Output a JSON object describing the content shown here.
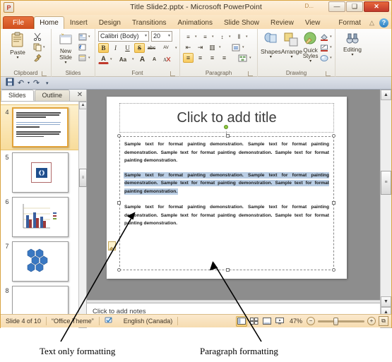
{
  "window": {
    "title": "Title Slide2.pptx  -  Microsoft PowerPoint",
    "app_logo": "P",
    "doc_badge": "D...",
    "minimize": "—",
    "maximize": "❑",
    "close": "✕"
  },
  "tabs": [
    {
      "label": "File",
      "state": "file"
    },
    {
      "label": "Home",
      "state": "active"
    },
    {
      "label": "Insert",
      "state": ""
    },
    {
      "label": "Design",
      "state": ""
    },
    {
      "label": "Transitions",
      "state": ""
    },
    {
      "label": "Animations",
      "state": ""
    },
    {
      "label": "Slide Show",
      "state": ""
    },
    {
      "label": "Review",
      "state": ""
    },
    {
      "label": "View",
      "state": ""
    },
    {
      "label": "Format",
      "state": "contextual"
    }
  ],
  "tab_right": {
    "minimize_ribbon": "△",
    "help": "?"
  },
  "ribbon": {
    "clipboard": {
      "label": "Clipboard",
      "paste_label": "Paste",
      "paste_caret": "▾",
      "cut_icon": "✂",
      "copy_icon": "❐",
      "format_painter_icon": "✒",
      "copy_caret": "▾",
      "launcher": "↘"
    },
    "slides": {
      "label": "Slides",
      "new_slide_label": "New\nSlide",
      "new_slide_caret": "▾",
      "layout_icon": "▤",
      "reset_icon": "↺",
      "section_icon": "▦",
      "layout_caret": "▾",
      "section_caret": "▾"
    },
    "font": {
      "label": "Font",
      "font_name": "Calibri (Body)",
      "font_size": "20",
      "dropdown_caret": "▾",
      "bold": "B",
      "italic": "I",
      "underline": "U",
      "shadow": "S",
      "strikethrough": "abc",
      "char_spacing": "AV",
      "font_color": "A",
      "change_case": "Aa",
      "grow_font": "A",
      "shrink_font": "A",
      "clear_format": "⌫",
      "launcher": "↘"
    },
    "paragraph": {
      "label": "Paragraph",
      "bullets": "≡",
      "numbering": "≡",
      "line_spacing": "↕",
      "text_direction": "‖",
      "decrease_indent": "⇤",
      "increase_indent": "⇥",
      "columns": "▥",
      "align_text": "↕",
      "align_left": "≡",
      "align_center": "≡",
      "align_right": "≡",
      "justify": "≡",
      "smartart": "▨",
      "launcher": "↘"
    },
    "drawing": {
      "label": "Drawing",
      "shapes_label": "Shapes",
      "arrange_label": "Arrange",
      "quick_styles_label": "Quick\nStyles",
      "shape_fill_icon": "◢",
      "shape_outline_icon": "✎",
      "shape_effects_icon": "◐",
      "caret": "▾",
      "launcher": "↘"
    },
    "editing": {
      "label": "Editing",
      "editing_label": "Editing",
      "find_icon": "⚲",
      "caret": "▾"
    }
  },
  "qat": {
    "save_icon": "Ὃe",
    "save_glyph": "▣",
    "undo_glyph": "↶",
    "undo_caret": "▾",
    "redo_glyph": "↷",
    "customize_caret": "▾"
  },
  "slide_pane": {
    "tabs": [
      {
        "label": "Slides",
        "active": true
      },
      {
        "label": "Outline",
        "active": false
      }
    ],
    "close_icon": "✕",
    "thumbnails": [
      {
        "number": "4",
        "selected": true,
        "kind": "text"
      },
      {
        "number": "5",
        "selected": false,
        "kind": "image"
      },
      {
        "number": "6",
        "selected": false,
        "kind": "chart"
      },
      {
        "number": "7",
        "selected": false,
        "kind": "smartart"
      },
      {
        "number": "8",
        "selected": false,
        "kind": "blank"
      }
    ],
    "scroll_up": "▲",
    "scroll_down": "▼",
    "scroll_grip": "≡"
  },
  "slide": {
    "title_placeholder": "Click to add title",
    "paragraphs": [
      {
        "id": "p1",
        "selected": false,
        "text": "Sample text for format painting demonstration. Sample text for format painting demonstration. Sample text for format painting demonstration. Sample text for format painting demonstration."
      },
      {
        "id": "p2",
        "selected": true,
        "text": "Sample text for format painting demonstration. Sample text for format painting demonstration. Sample text for format painting demonstration. Sample text for format painting demonstration."
      },
      {
        "id": "p3",
        "selected": false,
        "text": "Sample text for format painting demonstration. Sample text for format painting demonstration. Sample text for format painting demonstration. Sample text for format painting demonstration."
      }
    ]
  },
  "notes": {
    "placeholder": "Click to add notes"
  },
  "editor_scroll": {
    "up": "▲",
    "down": "▼",
    "prev_slide": "▲",
    "next_slide": "▼",
    "grip": "≡"
  },
  "statusbar": {
    "slide_counter": "Slide 4 of 10",
    "theme": "“Office Theme”",
    "spellcheck_icon": "✓",
    "language": "English (Canada)",
    "views": [
      {
        "name": "normal",
        "glyph": "▥",
        "active": true
      },
      {
        "name": "slide-sorter",
        "glyph": "▦",
        "active": false
      },
      {
        "name": "reading",
        "glyph": "▤",
        "active": false
      },
      {
        "name": "slide-show",
        "glyph": "▷",
        "active": false
      }
    ],
    "zoom_level": "47%",
    "zoom_out": "−",
    "zoom_in": "+",
    "fit_window": "⧉"
  },
  "annotations": [
    {
      "id": "a1",
      "label": "Text only formatting"
    },
    {
      "id": "a2",
      "label": "Paragraph formatting"
    }
  ],
  "colors": {
    "accent_orange": "#d9a441",
    "file_tab": "#cf4e1d",
    "selection_highlight": "#b9cde4",
    "rotate_handle": "#8ec641"
  }
}
